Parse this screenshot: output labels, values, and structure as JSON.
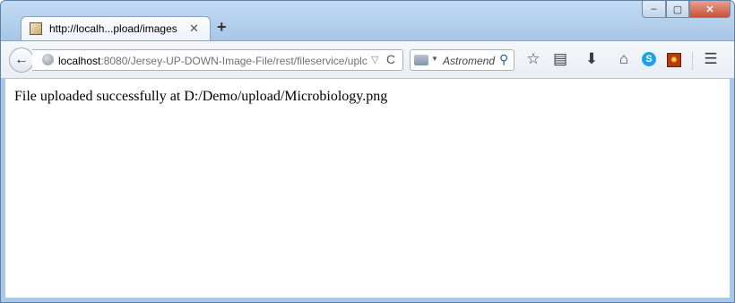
{
  "tab": {
    "title": "http://localh...pload/images",
    "close_symbol": "✕",
    "favicon": "page-favicon"
  },
  "new_tab_symbol": "+",
  "window_controls": {
    "minimize": "‒",
    "maximize": "▢",
    "close": "✕"
  },
  "nav": {
    "back_symbol": "←",
    "url_host": "localhost",
    "url_rest": ":8080/Jersey-UP-DOWN-Image-File/rest/fileservice/uplc",
    "dropdown_symbol": "▽",
    "reload_symbol": "C"
  },
  "search": {
    "placeholder": "Astromend",
    "dropdown_symbol": "▼",
    "glass_symbol": "⚲"
  },
  "toolbar_icons": [
    "star-icon",
    "reading-list-icon",
    "download-icon",
    "home-icon",
    "skype-icon",
    "addon-icon",
    "menu-icon"
  ],
  "toolbar_symbols": {
    "star": "☆",
    "reading": "▤",
    "download": "⬇",
    "home": "⌂",
    "skype": "S",
    "addon": "✹",
    "menu": "☰"
  },
  "page": {
    "message": "File uploaded successfully at D:/Demo/upload/Microbiology.png"
  },
  "colors": {
    "frame": "#a9c7e8",
    "content_bg": "#ffffff",
    "close_button": "#c9503b"
  }
}
